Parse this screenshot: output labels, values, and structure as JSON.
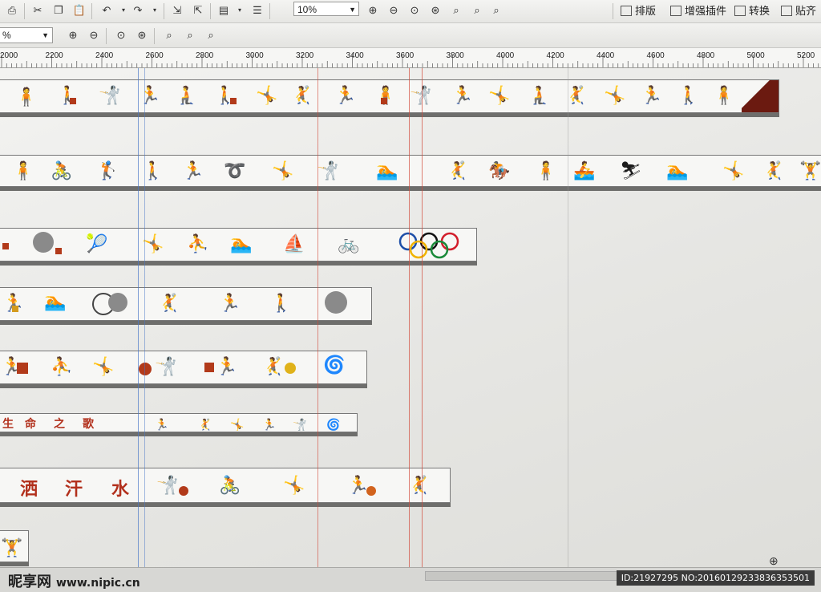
{
  "toolbar": {
    "zoom_value": "10%",
    "zoom_value2": "%",
    "menu": [
      {
        "label": "排版"
      },
      {
        "label": "增强插件"
      },
      {
        "label": "转换"
      },
      {
        "label": "贴齐"
      }
    ]
  },
  "ruler": {
    "ticks": [
      "2000",
      "2200",
      "2400",
      "2600",
      "2800",
      "3000",
      "3200",
      "3400",
      "3600",
      "3800",
      "4000",
      "4200",
      "4400",
      "4600",
      "4800",
      "5000",
      "5200"
    ]
  },
  "strips": {
    "strip6_text": [
      "生",
      "命",
      "之",
      "歌"
    ],
    "strip7_text": [
      "洒",
      "汗",
      "水"
    ]
  },
  "footer": {
    "site_name": "昵享网",
    "site_url": "www.nipic.cn",
    "image_id": "ID:21927295 NO:20160129233836353501"
  },
  "colors": {
    "accent_red": "#b23a1a",
    "guide_blue": "#4a78c8",
    "guide_red": "#d24a3a"
  }
}
